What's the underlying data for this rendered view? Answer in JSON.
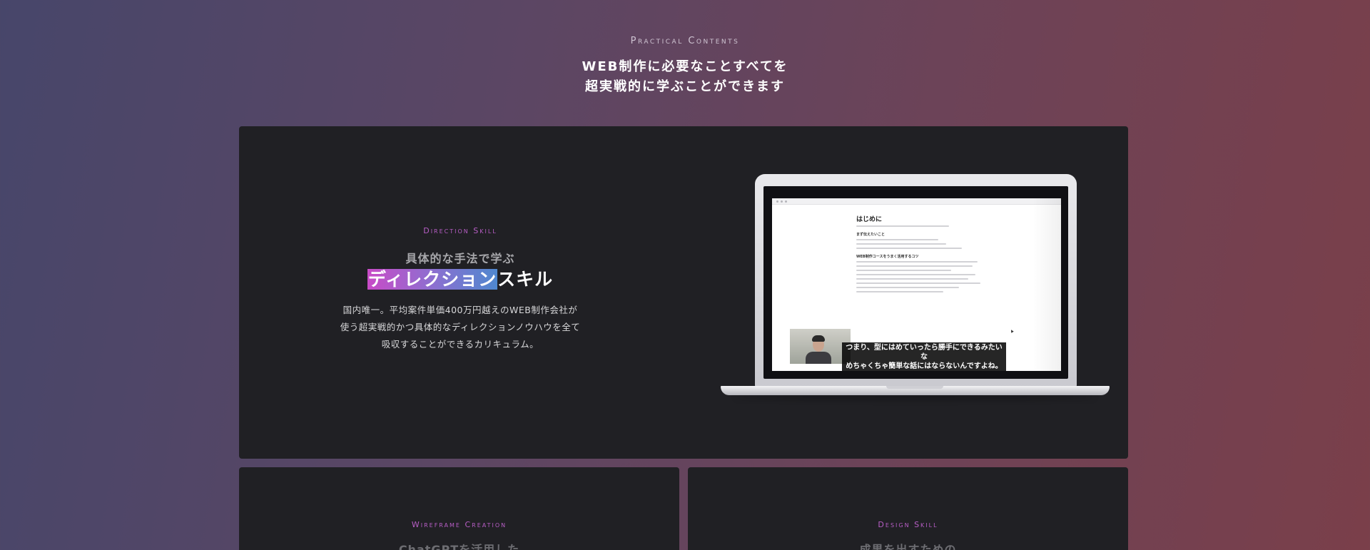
{
  "section": {
    "eyebrow": "Practical Contents",
    "headline_line1": "WEB制作に必要なことすべてを",
    "headline_line2": "超実戦的に学ぶことができます"
  },
  "main_card": {
    "label": "Direction Skill",
    "subtitle": "具体的な手法で学ぶ",
    "title_highlight": "ディレクション",
    "title_rest": "スキル",
    "description": "国内唯一。平均案件単価400万円越えのWEB制作会社が使う超実戦的かつ具体的なディレクションノウハウを全て吸収することができるカリキュラム。",
    "screen": {
      "doc_title": "はじめに",
      "section1": "まず伝えたいこと",
      "section2": "WEB制作コースをうまく活用するコツ",
      "caption_line1": "つまり、型にはめていったら勝手にできるみたいな",
      "caption_line2": "めちゃくちゃ簡単な話にはならないんですよね。"
    }
  },
  "cards": [
    {
      "label": "Wireframe Creation",
      "title": "ChatGPTを活用した"
    },
    {
      "label": "Design Skill",
      "title": "成果を出すための"
    }
  ],
  "colors": {
    "accent_label": "#b85ec6",
    "card_bg": "#202024",
    "highlight_gradient_start": "#c84bc7",
    "highlight_gradient_end": "#4f88cf"
  }
}
